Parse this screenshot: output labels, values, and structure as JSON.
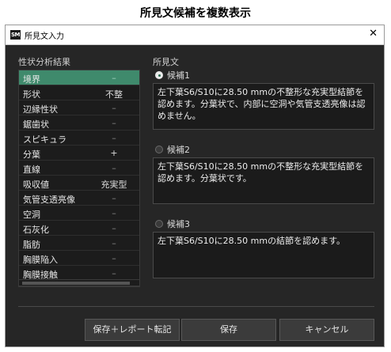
{
  "page_heading": "所見文候補を複数表示",
  "window": {
    "title": "所見文入力",
    "app_icon": "SM",
    "close_glyph": "✕"
  },
  "analysis": {
    "label": "性状分析結果",
    "rows": [
      {
        "name": "境界",
        "value": "–",
        "selected": true
      },
      {
        "name": "形状",
        "value": "不整"
      },
      {
        "name": "辺縁性状",
        "value": "–"
      },
      {
        "name": "鋸歯状",
        "value": "–"
      },
      {
        "name": "スピキュラ",
        "value": "–"
      },
      {
        "name": "分葉",
        "value": "+"
      },
      {
        "name": "直線",
        "value": "–"
      },
      {
        "name": "吸収値",
        "value": "充実型"
      },
      {
        "name": "気管支透亮像",
        "value": "–"
      },
      {
        "name": "空洞",
        "value": "–"
      },
      {
        "name": "石灰化",
        "value": "–"
      },
      {
        "name": "脂肪",
        "value": "–"
      },
      {
        "name": "胸膜陥入",
        "value": "–"
      },
      {
        "name": "胸膜接触",
        "value": "–"
      }
    ]
  },
  "findings": {
    "label": "所見文",
    "candidates": [
      {
        "label": "候補1",
        "selected": true,
        "text": "左下葉S6/S10に28.50 mmの不整形な充実型結節を認めます。分葉状で、内部に空洞や気管支透亮像は認めません。"
      },
      {
        "label": "候補2",
        "selected": false,
        "text": "左下葉S6/S10に28.50 mmの不整形な充実型結節を認めます。分葉状です。"
      },
      {
        "label": "候補3",
        "selected": false,
        "text": "左下葉S6/S10に28.50 mmの結節を認めます。"
      }
    ]
  },
  "buttons": {
    "save_report": "保存＋レポート転記",
    "save": "保存",
    "cancel": "キャンセル"
  },
  "colors": {
    "selected_row": "#3f8a6c",
    "panel_bg": "#262626"
  }
}
